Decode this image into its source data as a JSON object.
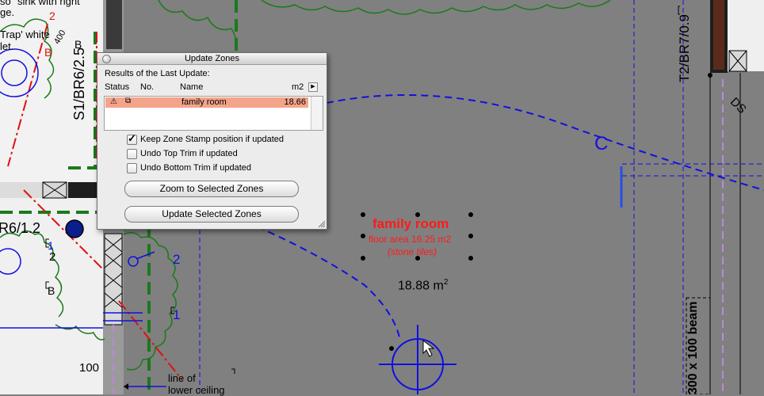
{
  "plan": {
    "zone_name": "family room",
    "zone_floor_area": "floor area 16.25 m2",
    "zone_material": "(stone tiles)",
    "zone_measured_area": "18.88 m",
    "zone_measured_unit_sup": "2",
    "section_marker": "C",
    "label_ds": "DS",
    "label_t2br": "T2/BR7/0.9",
    "label_s1br": "S1/BR6/2.5",
    "label_r6": "R6/1.2",
    "label_beam": "300 x 100 beam",
    "label_ceiling_line1": "line of",
    "label_ceiling_line2": "lower ceiling",
    "label_dim_100": "100",
    "label_sink_line1": "so\" sink with right",
    "label_sink_line2": "ge.",
    "label_trap_line1": "Trap' white",
    "label_trap_line2": "let.",
    "label_b_red": "B",
    "label_b_top": "B",
    "label_b_left": "B",
    "label_2_red": "2",
    "label_2_a": "2",
    "label_2_b": "2",
    "label_1_a": "1",
    "label_1_b": "1",
    "label_400": "400",
    "colors": {
      "background": "#808080",
      "zone_text": "#ff1a1a",
      "plan_blue": "#1010e0",
      "plan_green": "#1a7a1a",
      "plan_red": "#e01010",
      "selection_row": "#f4a48a"
    }
  },
  "dialog": {
    "title": "Update Zones",
    "results_label": "Results of the Last Update:",
    "columns": {
      "status": "Status",
      "no": "No.",
      "name": "Name",
      "area": "m2"
    },
    "rows": [
      {
        "status_icon": "warning-icon",
        "no_icon": "zone-stamp-icon",
        "name": "family room",
        "area": "18.66"
      }
    ],
    "options": [
      {
        "label": "Keep Zone Stamp position if updated",
        "checked": true
      },
      {
        "label": "Undo Top Trim if updated",
        "checked": false
      },
      {
        "label": "Undo Bottom Trim if updated",
        "checked": false
      }
    ],
    "buttons": {
      "zoom": "Zoom to Selected Zones",
      "update": "Update Selected Zones"
    }
  }
}
